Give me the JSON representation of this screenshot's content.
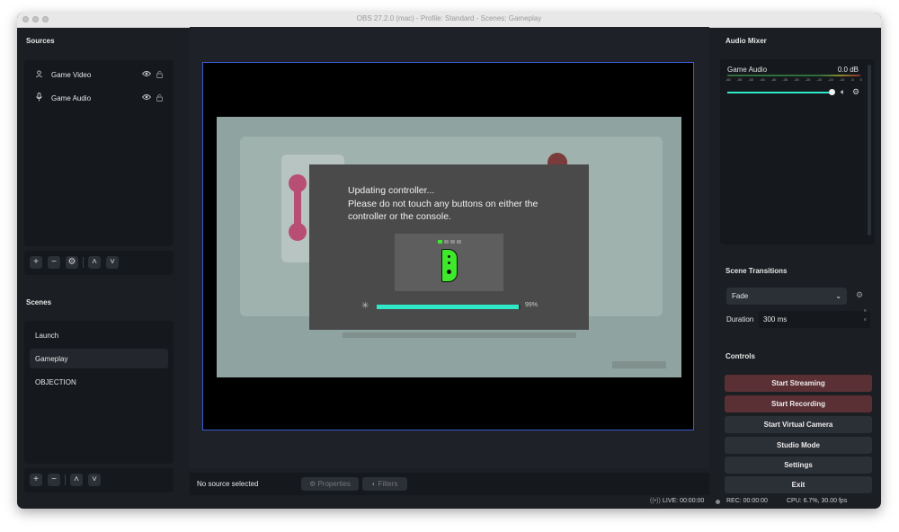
{
  "window": {
    "title": "OBS 27.2.0 (mac) - Profile: Standard - Scenes: Gameplay"
  },
  "sources": {
    "title": "Sources",
    "items": [
      {
        "label": "Game Video",
        "icon": "person-icon"
      },
      {
        "label": "Game Audio",
        "icon": "microphone-icon"
      }
    ],
    "toolbar": {
      "add": "+",
      "remove": "−",
      "settings": "⚙",
      "up": "˄",
      "down": "˅"
    }
  },
  "scenes": {
    "title": "Scenes",
    "items": [
      {
        "label": "Launch",
        "selected": false
      },
      {
        "label": "Gameplay",
        "selected": true
      },
      {
        "label": "OBJECTION",
        "selected": false
      }
    ],
    "toolbar": {
      "add": "+",
      "remove": "−",
      "up": "˄",
      "down": "˅"
    }
  },
  "preview": {
    "dialog_line1": "Updating controller...",
    "dialog_line2": "Please do not touch any buttons on either the",
    "dialog_line3": "controller or the console.",
    "progress_percent": 99,
    "progress_label": "99%",
    "progress_color": "#2fe8c8",
    "joycon_color": "#3ee82a"
  },
  "properties_bar": {
    "status": "No source selected",
    "properties_label": "Properties",
    "filters_label": "Filters"
  },
  "audio_mixer": {
    "title": "Audio Mixer",
    "channel_name": "Game Audio",
    "level": "0.0 dB",
    "scale": [
      "-60",
      "-55",
      "-50",
      "-45",
      "-40",
      "-35",
      "-30",
      "-25",
      "-20",
      "-15",
      "-10",
      "-5",
      "0"
    ],
    "volume_fraction": 1.0
  },
  "transitions": {
    "title": "Scene Transitions",
    "selected": "Fade",
    "duration_label": "Duration",
    "duration_value": "300 ms"
  },
  "controls": {
    "title": "Controls",
    "start_streaming": "Start Streaming",
    "start_recording": "Start Recording",
    "start_virtual_camera": "Start Virtual Camera",
    "studio_mode": "Studio Mode",
    "settings": "Settings",
    "exit": "Exit"
  },
  "status": {
    "live": "LIVE: 00:00:00",
    "rec": "REC: 00:00:00",
    "cpu": "CPU: 6.7%, 30.00 fps"
  },
  "colors": {
    "accent_red": "#5a3035",
    "preview_border": "#3b5bd6",
    "panel_bg": "#15181c",
    "window_bg": "#1b1e23"
  }
}
